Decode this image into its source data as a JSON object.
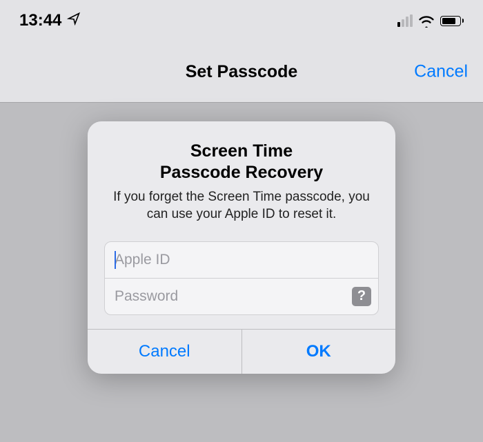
{
  "status": {
    "time": "13:44"
  },
  "nav": {
    "title": "Set Passcode",
    "cancel_label": "Cancel"
  },
  "alert": {
    "title_line1": "Screen Time",
    "title_line2": "Passcode Recovery",
    "message": "If you forget the Screen Time passcode, you can use your Apple ID to reset it.",
    "apple_id_placeholder": "Apple ID",
    "password_placeholder": "Password",
    "help_label": "?",
    "cancel_label": "Cancel",
    "ok_label": "OK"
  }
}
